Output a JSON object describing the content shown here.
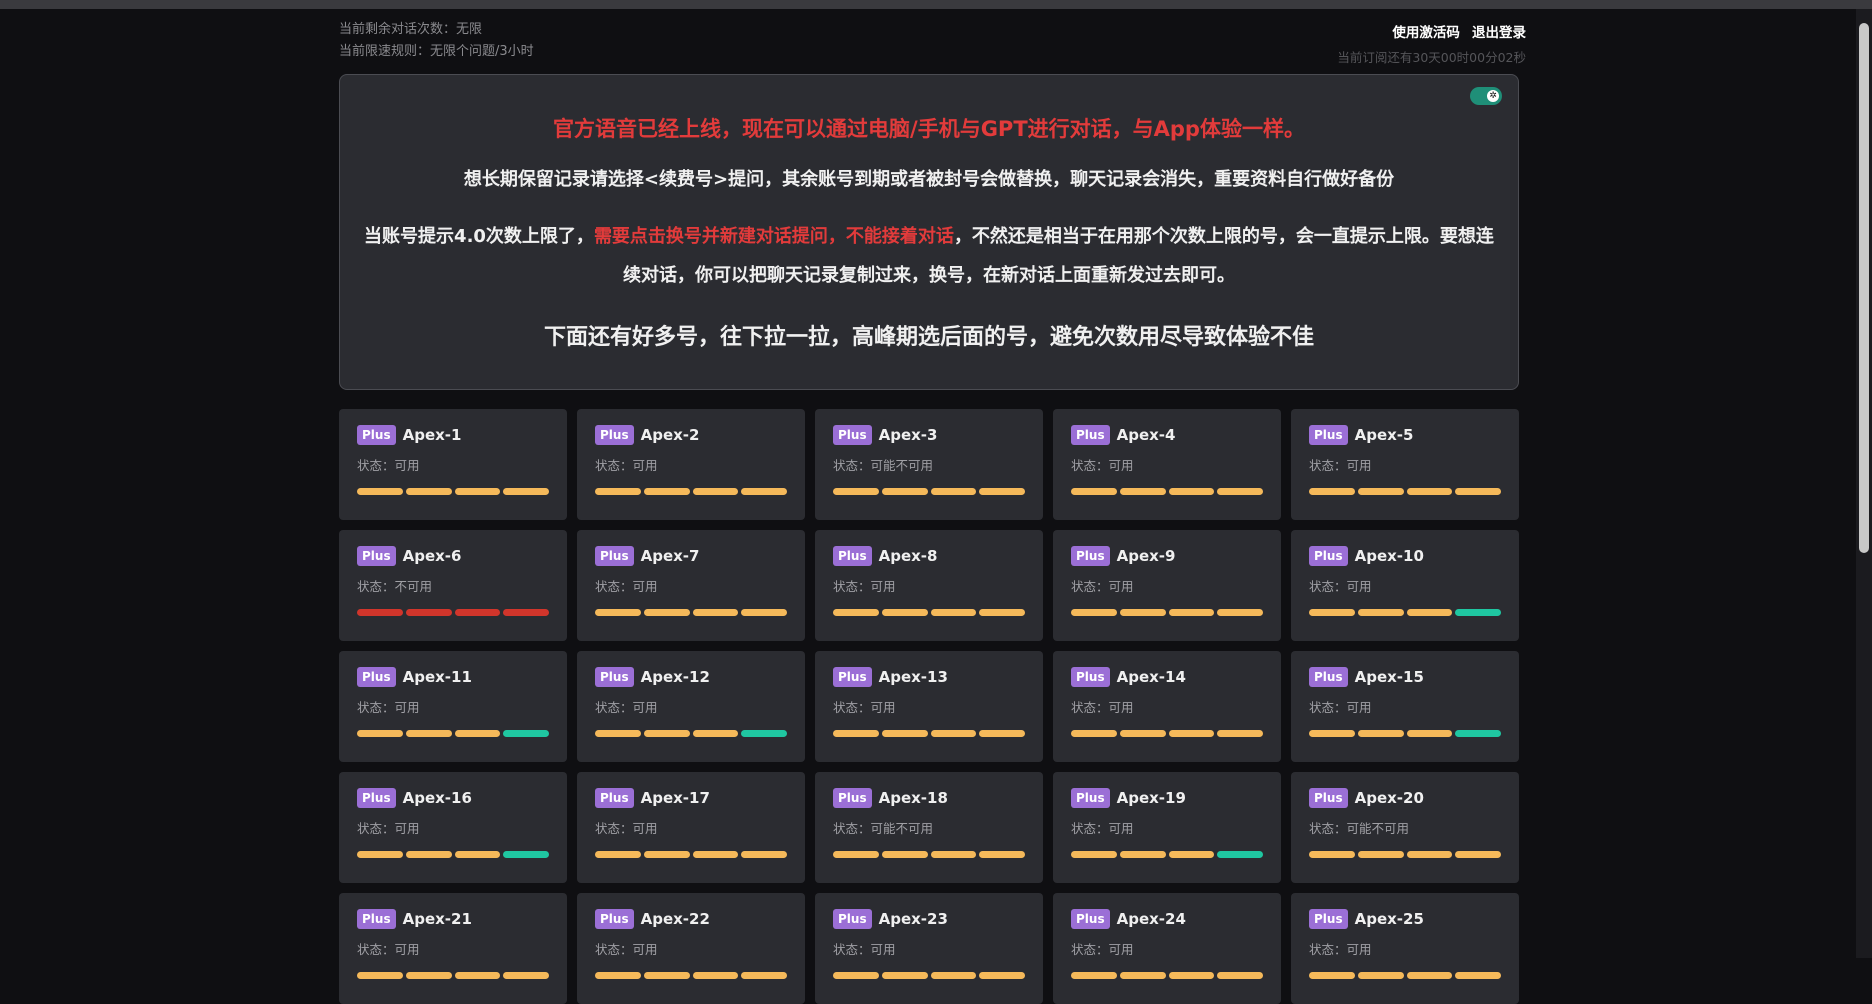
{
  "header": {
    "remaining_label": "当前剩余对话次数：无限",
    "rate_rule_label": "当前限速规则：无限个问题/3小时",
    "activate_link": "使用激活码",
    "logout_link": "退出登录",
    "subscription_countdown": "当前订阅还有30天00时00分02秒"
  },
  "notice": {
    "line1": "官方语音已经上线，现在可以通过电脑/手机与GPT进行对话，与App体验一样。",
    "line2": "想长期保留记录请选择<续费号>提问，其余账号到期或者被封号会做替换，聊天记录会消失，重要资料自行做好备份",
    "line3_part1": "当账号提示4.0次数上限了，",
    "line3_red": "需要点击换号并新建对话提问，不能接着对话",
    "line3_part2": "，不然还是相当于在用那个次数上限的号，会一直提示上限。要想连续对话，你可以把聊天记录复制过来，换号，在新对话上面重新发过去即可。",
    "line4": "下面还有好多号，往下拉一拉，高峰期选后面的号，避免次数用尽导致体验不佳",
    "toggle_icon": "theme-toggle-icon"
  },
  "colors": {
    "bar_orange": "#f5b95a",
    "bar_green": "#1fc7a1",
    "bar_red": "#d1352b",
    "plus_badge": "#9b6fd6"
  },
  "accounts": [
    {
      "badge": "Plus",
      "name": "Apex-1",
      "status": "状态：可用",
      "bars": [
        "orange",
        "orange",
        "orange",
        "orange"
      ]
    },
    {
      "badge": "Plus",
      "name": "Apex-2",
      "status": "状态：可用",
      "bars": [
        "orange",
        "orange",
        "orange",
        "orange"
      ]
    },
    {
      "badge": "Plus",
      "name": "Apex-3",
      "status": "状态：可能不可用",
      "bars": [
        "orange",
        "orange",
        "orange",
        "orange"
      ]
    },
    {
      "badge": "Plus",
      "name": "Apex-4",
      "status": "状态：可用",
      "bars": [
        "orange",
        "orange",
        "orange",
        "orange"
      ]
    },
    {
      "badge": "Plus",
      "name": "Apex-5",
      "status": "状态：可用",
      "bars": [
        "orange",
        "orange",
        "orange",
        "orange"
      ]
    },
    {
      "badge": "Plus",
      "name": "Apex-6",
      "status": "状态：不可用",
      "bars": [
        "red",
        "red",
        "red",
        "red"
      ]
    },
    {
      "badge": "Plus",
      "name": "Apex-7",
      "status": "状态：可用",
      "bars": [
        "orange",
        "orange",
        "orange",
        "orange"
      ]
    },
    {
      "badge": "Plus",
      "name": "Apex-8",
      "status": "状态：可用",
      "bars": [
        "orange",
        "orange",
        "orange",
        "orange"
      ]
    },
    {
      "badge": "Plus",
      "name": "Apex-9",
      "status": "状态：可用",
      "bars": [
        "orange",
        "orange",
        "orange",
        "orange"
      ]
    },
    {
      "badge": "Plus",
      "name": "Apex-10",
      "status": "状态：可用",
      "bars": [
        "orange",
        "orange",
        "orange",
        "green"
      ]
    },
    {
      "badge": "Plus",
      "name": "Apex-11",
      "status": "状态：可用",
      "bars": [
        "orange",
        "orange",
        "orange",
        "green"
      ]
    },
    {
      "badge": "Plus",
      "name": "Apex-12",
      "status": "状态：可用",
      "bars": [
        "orange",
        "orange",
        "orange",
        "green"
      ]
    },
    {
      "badge": "Plus",
      "name": "Apex-13",
      "status": "状态：可用",
      "bars": [
        "orange",
        "orange",
        "orange",
        "orange"
      ]
    },
    {
      "badge": "Plus",
      "name": "Apex-14",
      "status": "状态：可用",
      "bars": [
        "orange",
        "orange",
        "orange",
        "orange"
      ]
    },
    {
      "badge": "Plus",
      "name": "Apex-15",
      "status": "状态：可用",
      "bars": [
        "orange",
        "orange",
        "orange",
        "green"
      ]
    },
    {
      "badge": "Plus",
      "name": "Apex-16",
      "status": "状态：可用",
      "bars": [
        "orange",
        "orange",
        "orange",
        "green"
      ]
    },
    {
      "badge": "Plus",
      "name": "Apex-17",
      "status": "状态：可用",
      "bars": [
        "orange",
        "orange",
        "orange",
        "orange"
      ]
    },
    {
      "badge": "Plus",
      "name": "Apex-18",
      "status": "状态：可能不可用",
      "bars": [
        "orange",
        "orange",
        "orange",
        "orange"
      ]
    },
    {
      "badge": "Plus",
      "name": "Apex-19",
      "status": "状态：可用",
      "bars": [
        "orange",
        "orange",
        "orange",
        "green"
      ]
    },
    {
      "badge": "Plus",
      "name": "Apex-20",
      "status": "状态：可能不可用",
      "bars": [
        "orange",
        "orange",
        "orange",
        "orange"
      ]
    },
    {
      "badge": "Plus",
      "name": "Apex-21",
      "status": "状态：可用",
      "bars": [
        "orange",
        "orange",
        "orange",
        "orange"
      ]
    },
    {
      "badge": "Plus",
      "name": "Apex-22",
      "status": "状态：可用",
      "bars": [
        "orange",
        "orange",
        "orange",
        "orange"
      ]
    },
    {
      "badge": "Plus",
      "name": "Apex-23",
      "status": "状态：可用",
      "bars": [
        "orange",
        "orange",
        "orange",
        "orange"
      ]
    },
    {
      "badge": "Plus",
      "name": "Apex-24",
      "status": "状态：可用",
      "bars": [
        "orange",
        "orange",
        "orange",
        "orange"
      ]
    },
    {
      "badge": "Plus",
      "name": "Apex-25",
      "status": "状态：可用",
      "bars": [
        "orange",
        "orange",
        "orange",
        "orange"
      ]
    }
  ]
}
